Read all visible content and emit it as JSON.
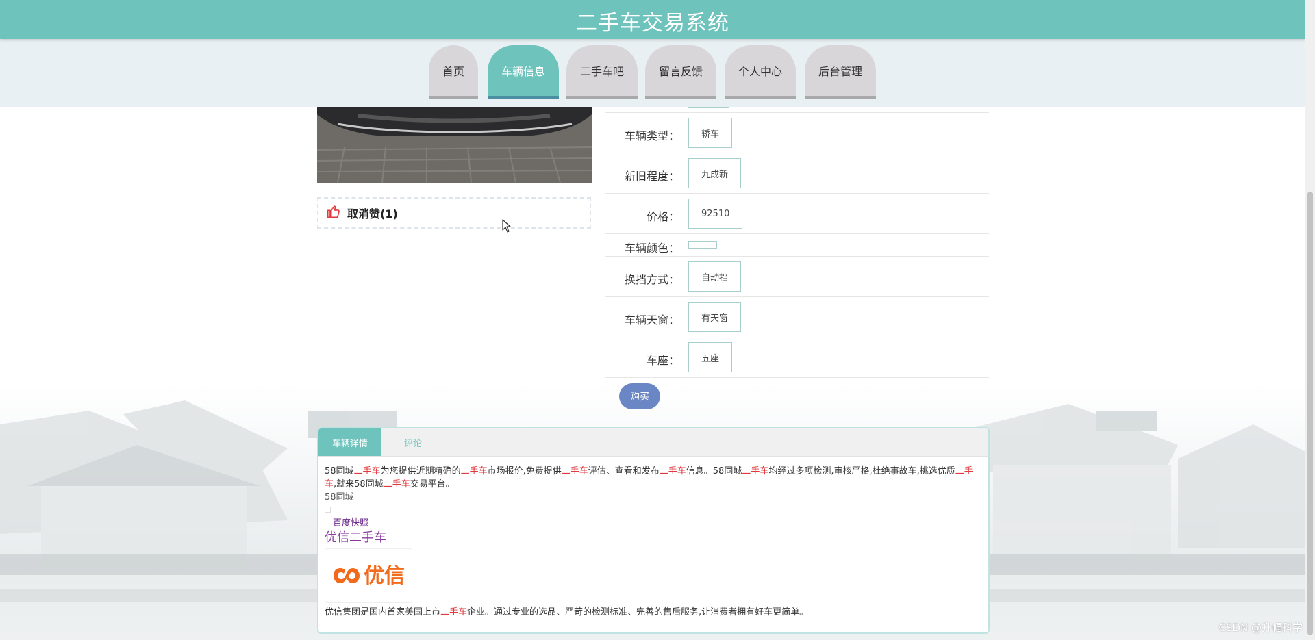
{
  "header": {
    "title": "二手车交易系统"
  },
  "nav": {
    "items": [
      {
        "label": "首页",
        "active": false
      },
      {
        "label": "车辆信息",
        "active": true
      },
      {
        "label": "二手车吧",
        "active": false
      },
      {
        "label": "留言反馈",
        "active": false
      },
      {
        "label": "个人中心",
        "active": false
      },
      {
        "label": "后台管理",
        "active": false
      }
    ]
  },
  "like": {
    "label": "取消赞(1)"
  },
  "info": {
    "rows": [
      {
        "label": "车辆类型：",
        "value": "轿车"
      },
      {
        "label": "新旧程度：",
        "value": "九成新"
      },
      {
        "label": "价格：",
        "value": "92510"
      },
      {
        "label": "车辆颜色：",
        "value": ""
      },
      {
        "label": "换挡方式：",
        "value": "自动挡"
      },
      {
        "label": "车辆天窗：",
        "value": "有天窗"
      },
      {
        "label": "车座：",
        "value": "五座"
      }
    ],
    "buy_label": "购买"
  },
  "detail": {
    "tabs": [
      {
        "label": "车辆详情",
        "active": true
      },
      {
        "label": "评论",
        "active": false
      }
    ],
    "intro_segments": [
      {
        "text": "58同城",
        "hl": false
      },
      {
        "text": "二手车",
        "hl": true
      },
      {
        "text": "为您提供近期精确的",
        "hl": false
      },
      {
        "text": "二手车",
        "hl": true
      },
      {
        "text": "市场报价,免费提供",
        "hl": false
      },
      {
        "text": "二手车",
        "hl": true
      },
      {
        "text": "评估、查看和发布",
        "hl": false
      },
      {
        "text": "二手车",
        "hl": true
      },
      {
        "text": "信息。58同城",
        "hl": false
      },
      {
        "text": "二手车",
        "hl": true
      },
      {
        "text": "均经过多项检测,审核严格,杜绝事故车,挑选优质",
        "hl": false
      },
      {
        "text": "二手车",
        "hl": true
      },
      {
        "text": ",就来58同城",
        "hl": false
      },
      {
        "text": "二手车",
        "hl": true
      },
      {
        "text": "交易平台。",
        "hl": false
      }
    ],
    "source": "58同城",
    "snapshot_link": "百度快照",
    "brand_title": "优信二手车",
    "logo_text": "优信",
    "desc_segments": [
      {
        "text": "优信集团是国内首家美国上市",
        "hl": false
      },
      {
        "text": "二手车",
        "hl": true
      },
      {
        "text": "企业。通过专业的选品、严苛的检测标准、完善的售后服务,让消费者拥有好车更简单。",
        "hl": false
      }
    ]
  },
  "watermark": "CSDN @升幅科学",
  "colors": {
    "theme": "#6fc3bd",
    "nav_inactive": "#d8d6d9",
    "buy": "#6b86c4",
    "highlight": "#e0393e"
  }
}
